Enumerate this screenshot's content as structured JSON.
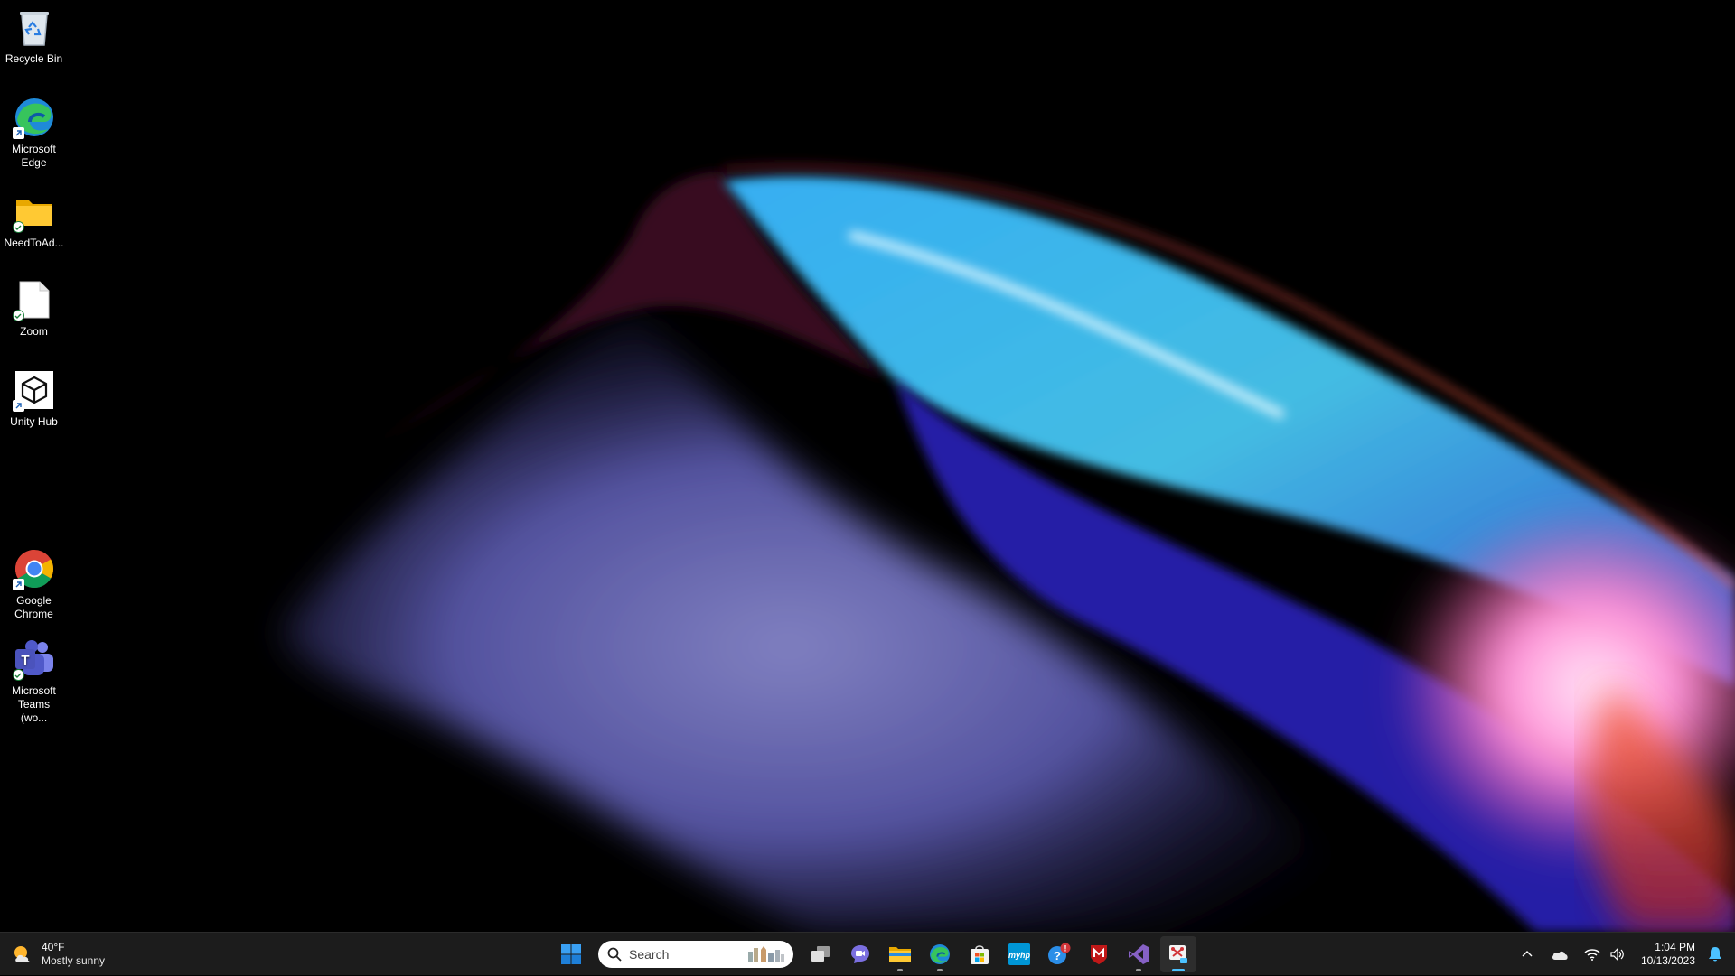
{
  "desktop": {
    "icons": [
      {
        "label": "Recycle Bin",
        "icon": "recycle-bin-icon"
      },
      {
        "label": "Microsoft Edge",
        "icon": "edge-icon"
      },
      {
        "label": "NeedToAd...",
        "icon": "folder-icon"
      },
      {
        "label": "Zoom",
        "icon": "document-icon"
      },
      {
        "label": "Unity Hub",
        "icon": "unity-icon"
      },
      {
        "label": "Google Chrome",
        "icon": "chrome-icon"
      },
      {
        "label": "Microsoft Teams (wo...",
        "icon": "teams-icon"
      }
    ]
  },
  "taskbar": {
    "weather": {
      "temperature": "40°F",
      "condition": "Mostly sunny",
      "icon": "sun-cloud-icon"
    },
    "search": {
      "placeholder": "Search"
    },
    "pinned": [
      {
        "name": "start",
        "icon": "windows-start-icon"
      },
      {
        "name": "task-view",
        "icon": "task-view-icon"
      },
      {
        "name": "teams-chat",
        "icon": "teams-chat-icon"
      },
      {
        "name": "file-explorer",
        "icon": "folder-icon",
        "running": true
      },
      {
        "name": "edge",
        "icon": "edge-icon",
        "running": true
      },
      {
        "name": "microsoft-store",
        "icon": "store-icon"
      },
      {
        "name": "myhp",
        "icon": "myhp-icon",
        "text": "myhp"
      },
      {
        "name": "get-help",
        "icon": "help-icon",
        "badge": "!"
      },
      {
        "name": "mcafee",
        "icon": "mcafee-icon"
      },
      {
        "name": "visual-studio",
        "icon": "visual-studio-icon",
        "running": true
      },
      {
        "name": "snipping-tool",
        "icon": "snipping-tool-icon",
        "running": true,
        "focused": true
      }
    ],
    "clock": {
      "time": "1:04 PM",
      "date": "10/13/2023"
    },
    "tray": [
      "chevron-up-icon",
      "onedrive-icon",
      "wifi-icon",
      "volume-icon",
      "notification-bell-icon"
    ]
  },
  "colors": {
    "taskbar_bg": "#1c1c1c",
    "accent": "#4cc2ff",
    "desktop_bg": "#000000"
  }
}
